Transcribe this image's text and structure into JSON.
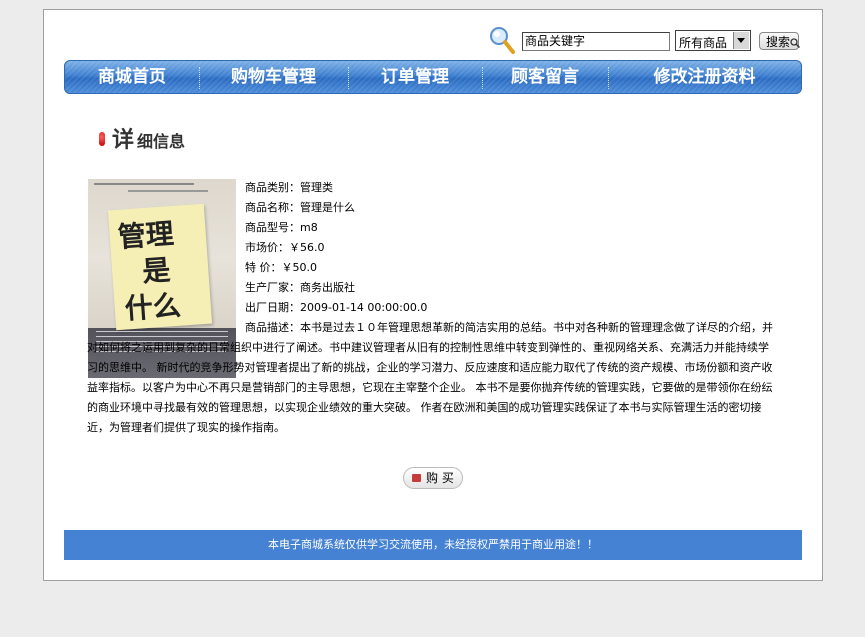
{
  "search": {
    "keyword_value": "商品关键字",
    "category_selected": "所有商品",
    "button_label": "搜索"
  },
  "nav": {
    "items": [
      "商城首页",
      "购物车管理",
      "订单管理",
      "顾客留言",
      "修改注册资料"
    ]
  },
  "heading": {
    "big": "详",
    "small": "细信息"
  },
  "product": {
    "fields": [
      "商品类别：管理类",
      "商品名称：管理是什么",
      "商品型号：m8",
      "市场价：￥56.0",
      "特  价：￥50.0",
      "生产厂家：商务出版社",
      "出厂日期：2009-01-14 00:00:00.0"
    ],
    "description": "商品描述：本书是过去１０年管理思想革新的简洁实用的总结。书中对各种新的管理理念做了详尽的介绍，并对如何将之运用到复杂的日常组织中进行了阐述。书中建议管理者从旧有的控制性思维中转变到弹性的、重视网络关系、充满活力并能持续学习的思维中。 新时代的竞争形势对管理者提出了新的挑战，企业的学习潜力、反应速度和适应能力取代了传统的资产规模、市场份额和资产收益率指标。以客户为中心不再只是营销部门的主导思想，它现在主宰整个企业。 本书不是要你抛弃传统的管理实践，它要做的是带领你在纷纭的商业环境中寻找最有效的管理思想，以实现企业绩效的重大突破。 作者在欧洲和美国的成功管理实践保证了本书与实际管理生活的密切接近，为管理者们提供了现实的操作指南。",
    "cover_title_chars": [
      "管理",
      "是",
      "什么"
    ]
  },
  "buy_button": {
    "label": "购 买"
  },
  "footer": {
    "text": "本电子商城系统仅供学习交流使用，未经授权严禁用于商业用途！！"
  },
  "colors": {
    "nav": "#3d7fd0",
    "footer": "#4682d4",
    "accent": "#c00000"
  }
}
